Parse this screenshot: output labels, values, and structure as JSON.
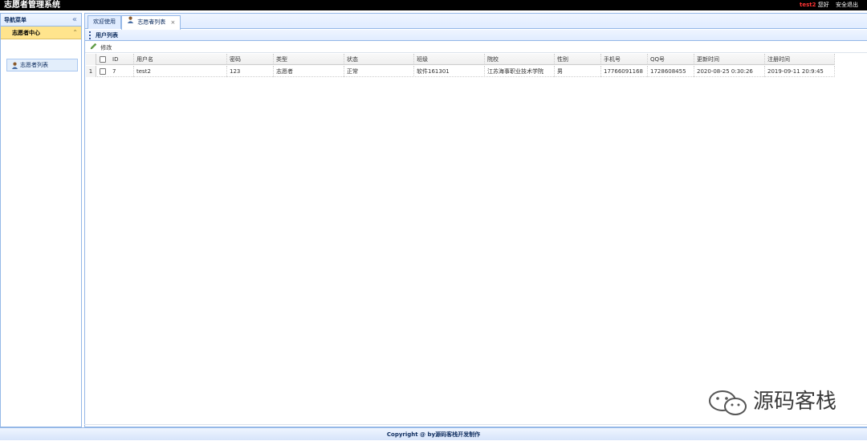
{
  "app": {
    "title": "志愿者管理系统",
    "user_name": "test2",
    "greeting": "您好",
    "logout_label": "安全退出"
  },
  "sidebar": {
    "title": "导航菜单",
    "collapse_symbol": "«",
    "section_title": "志愿者中心",
    "section_toggle": "⌃",
    "items": [
      {
        "label": "志愿者列表",
        "icon": "user-icon"
      }
    ]
  },
  "tabs": [
    {
      "label": "欢迎使用",
      "closable": false,
      "active": false
    },
    {
      "label": "志愿者列表",
      "closable": true,
      "active": true,
      "close_symbol": "×"
    }
  ],
  "panel": {
    "title": "用户列表",
    "toolbar": {
      "edit_label": "修改"
    }
  },
  "table": {
    "columns": [
      "ID",
      "用户名",
      "密码",
      "类型",
      "状态",
      "班级",
      "院校",
      "性别",
      "手机号",
      "QQ号",
      "更新时间",
      "注册时间"
    ],
    "rows": [
      {
        "rownum": "1",
        "cells": [
          "7",
          "test2",
          "123",
          "志愿者",
          "正常",
          "软件161301",
          "江苏海事职业技术学院",
          "男",
          "17766091168",
          "1728608455",
          "2020-08-25 0:30:26",
          "2019-09-11 20:9:45"
        ]
      }
    ]
  },
  "footer": {
    "text": "Copyright @ by源码客栈开发制作"
  },
  "watermark": {
    "text": "源码客栈"
  },
  "colors": {
    "topbar": "#000000",
    "accent_border": "#95b8e7",
    "selected_section": "#ffe48d",
    "username": "#ff3333"
  }
}
